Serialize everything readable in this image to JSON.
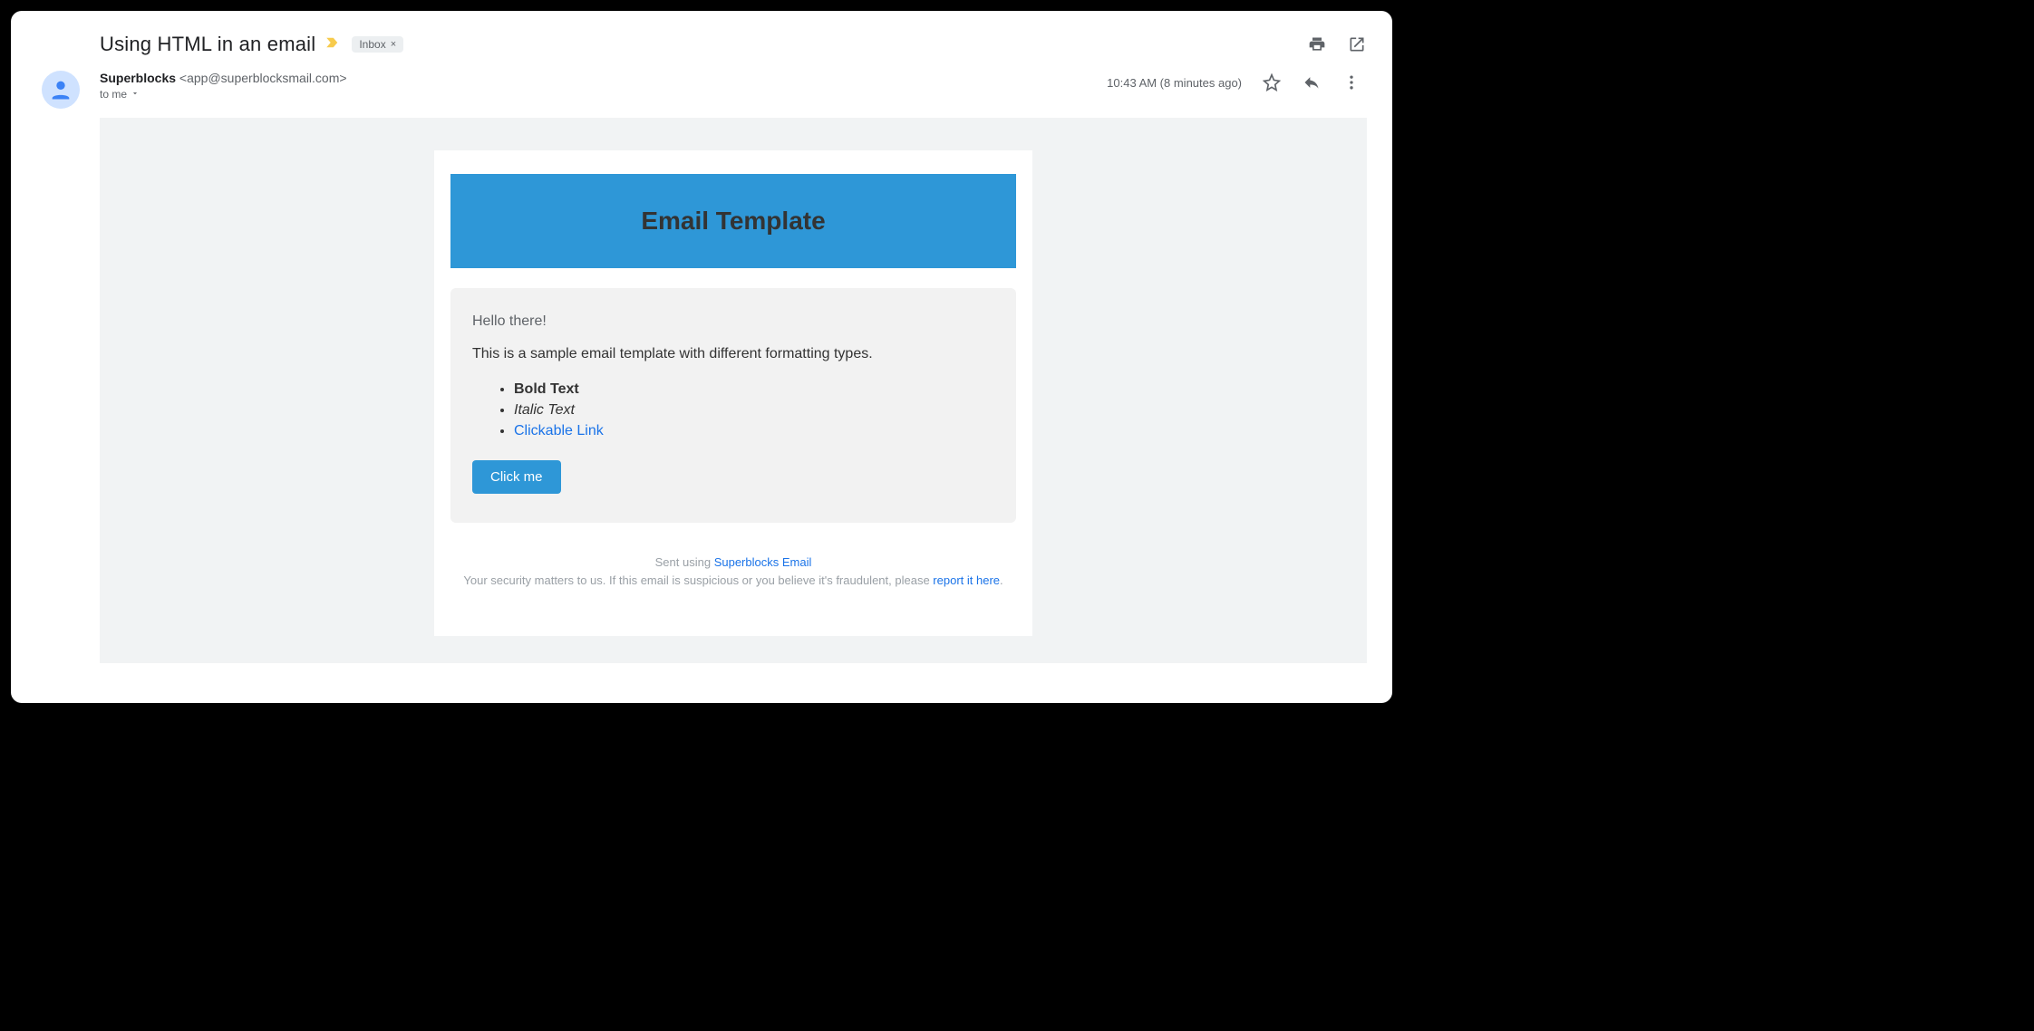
{
  "subject": "Using HTML in an email",
  "inbox_chip": {
    "label": "Inbox",
    "close": "×"
  },
  "sender": {
    "name": "Superblocks",
    "email_display": " <app@superblocksmail.com>"
  },
  "recipient": {
    "to_label": "to me"
  },
  "meta": {
    "timestamp": "10:43 AM (8 minutes ago)"
  },
  "template": {
    "hero_title": "Email Template",
    "greeting": "Hello there!",
    "intro": "This is a sample email template with different formatting types.",
    "items": {
      "bold": "Bold Text",
      "italic": "Italic Text",
      "link": "Clickable Link"
    },
    "cta_label": "Click me"
  },
  "footer": {
    "sent_using_prefix": "Sent using ",
    "sent_using_link": "Superblocks Email",
    "security_prefix": "Your security matters to us. If this email is suspicious or you believe it's fraudulent, please ",
    "report_link": "report it here",
    "period": "."
  }
}
